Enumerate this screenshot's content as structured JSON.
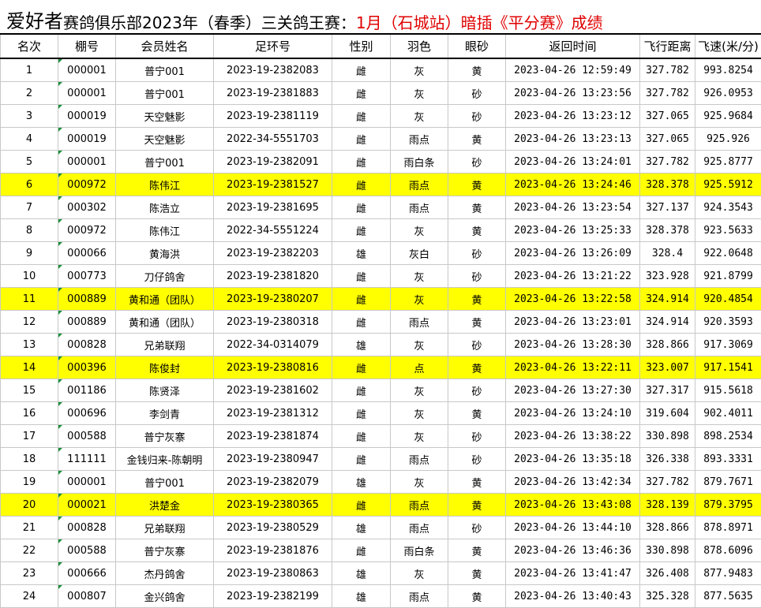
{
  "title": {
    "part1": "爱好者",
    "part2": "赛鸽俱乐部2023年（春季）三关鸽王赛：",
    "part3": "1月（石城站）暗插《平分赛》成绩"
  },
  "columns": [
    "名次",
    "棚号",
    "会员姓名",
    "足环号",
    "性别",
    "羽色",
    "眼砂",
    "返回时间",
    "飞行距离",
    "飞速(米/分)"
  ],
  "highlight_color": "#ffff00",
  "rows": [
    {
      "rank": "1",
      "loft": "000001",
      "name": "普宁001",
      "ring": "2023-19-2382083",
      "sex": "雌",
      "color": "灰",
      "eye": "黄",
      "time": "2023-04-26 12:59:49",
      "dist": "327.782",
      "speed": "993.8254",
      "hl": false
    },
    {
      "rank": "2",
      "loft": "000001",
      "name": "普宁001",
      "ring": "2023-19-2381883",
      "sex": "雌",
      "color": "灰",
      "eye": "砂",
      "time": "2023-04-26 13:23:56",
      "dist": "327.782",
      "speed": "926.0953",
      "hl": false
    },
    {
      "rank": "3",
      "loft": "000019",
      "name": "天空魅影",
      "ring": "2023-19-2381119",
      "sex": "雌",
      "color": "灰",
      "eye": "砂",
      "time": "2023-04-26 13:23:12",
      "dist": "327.065",
      "speed": "925.9684",
      "hl": false
    },
    {
      "rank": "4",
      "loft": "000019",
      "name": "天空魅影",
      "ring": "2022-34-5551703",
      "sex": "雌",
      "color": "雨点",
      "eye": "黄",
      "time": "2023-04-26 13:23:13",
      "dist": "327.065",
      "speed": "925.926",
      "hl": false
    },
    {
      "rank": "5",
      "loft": "000001",
      "name": "普宁001",
      "ring": "2023-19-2382091",
      "sex": "雌",
      "color": "雨白条",
      "eye": "砂",
      "time": "2023-04-26 13:24:01",
      "dist": "327.782",
      "speed": "925.8777",
      "hl": false
    },
    {
      "rank": "6",
      "loft": "000972",
      "name": "陈伟江",
      "ring": "2023-19-2381527",
      "sex": "雌",
      "color": "雨点",
      "eye": "黄",
      "time": "2023-04-26 13:24:46",
      "dist": "328.378",
      "speed": "925.5912",
      "hl": true
    },
    {
      "rank": "7",
      "loft": "000302",
      "name": "陈浩立",
      "ring": "2023-19-2381695",
      "sex": "雌",
      "color": "雨点",
      "eye": "黄",
      "time": "2023-04-26 13:23:54",
      "dist": "327.137",
      "speed": "924.3543",
      "hl": false
    },
    {
      "rank": "8",
      "loft": "000972",
      "name": "陈伟江",
      "ring": "2022-34-5551224",
      "sex": "雌",
      "color": "灰",
      "eye": "黄",
      "time": "2023-04-26 13:25:33",
      "dist": "328.378",
      "speed": "923.5633",
      "hl": false
    },
    {
      "rank": "9",
      "loft": "000066",
      "name": "黄海洪",
      "ring": "2023-19-2382203",
      "sex": "雄",
      "color": "灰白",
      "eye": "砂",
      "time": "2023-04-26 13:26:09",
      "dist": "328.4",
      "speed": "922.0648",
      "hl": false
    },
    {
      "rank": "10",
      "loft": "000773",
      "name": "刀仔鸽舍",
      "ring": "2023-19-2381820",
      "sex": "雌",
      "color": "灰",
      "eye": "砂",
      "time": "2023-04-26 13:21:22",
      "dist": "323.928",
      "speed": "921.8799",
      "hl": false
    },
    {
      "rank": "11",
      "loft": "000889",
      "name": "黄和通（团队）",
      "ring": "2023-19-2380207",
      "sex": "雌",
      "color": "灰",
      "eye": "黄",
      "time": "2023-04-26 13:22:58",
      "dist": "324.914",
      "speed": "920.4854",
      "hl": true
    },
    {
      "rank": "12",
      "loft": "000889",
      "name": "黄和通（团队）",
      "ring": "2023-19-2380318",
      "sex": "雌",
      "color": "雨点",
      "eye": "黄",
      "time": "2023-04-26 13:23:01",
      "dist": "324.914",
      "speed": "920.3593",
      "hl": false
    },
    {
      "rank": "13",
      "loft": "000828",
      "name": "兄弟联翔",
      "ring": "2022-34-0314079",
      "sex": "雄",
      "color": "灰",
      "eye": "砂",
      "time": "2023-04-26 13:28:30",
      "dist": "328.866",
      "speed": "917.3069",
      "hl": false
    },
    {
      "rank": "14",
      "loft": "000396",
      "name": "陈俊封",
      "ring": "2023-19-2380816",
      "sex": "雌",
      "color": "点",
      "eye": "黄",
      "time": "2023-04-26 13:22:11",
      "dist": "323.007",
      "speed": "917.1541",
      "hl": true
    },
    {
      "rank": "15",
      "loft": "001186",
      "name": "陈贤泽",
      "ring": "2023-19-2381602",
      "sex": "雌",
      "color": "灰",
      "eye": "砂",
      "time": "2023-04-26 13:27:30",
      "dist": "327.317",
      "speed": "915.5618",
      "hl": false
    },
    {
      "rank": "16",
      "loft": "000696",
      "name": "李剑青",
      "ring": "2023-19-2381312",
      "sex": "雌",
      "color": "灰",
      "eye": "黄",
      "time": "2023-04-26 13:24:10",
      "dist": "319.604",
      "speed": "902.4011",
      "hl": false
    },
    {
      "rank": "17",
      "loft": "000588",
      "name": "普宁灰寨",
      "ring": "2023-19-2381874",
      "sex": "雌",
      "color": "灰",
      "eye": "砂",
      "time": "2023-04-26 13:38:22",
      "dist": "330.898",
      "speed": "898.2534",
      "hl": false
    },
    {
      "rank": "18",
      "loft": "111111",
      "name": "金钱归来-陈朝明",
      "ring": "2023-19-2380947",
      "sex": "雌",
      "color": "雨点",
      "eye": "砂",
      "time": "2023-04-26 13:35:18",
      "dist": "326.338",
      "speed": "893.3331",
      "hl": false
    },
    {
      "rank": "19",
      "loft": "000001",
      "name": "普宁001",
      "ring": "2023-19-2382079",
      "sex": "雄",
      "color": "灰",
      "eye": "黄",
      "time": "2023-04-26 13:42:34",
      "dist": "327.782",
      "speed": "879.7671",
      "hl": false
    },
    {
      "rank": "20",
      "loft": "000021",
      "name": "洪楚金",
      "ring": "2023-19-2380365",
      "sex": "雌",
      "color": "雨点",
      "eye": "黄",
      "time": "2023-04-26 13:43:08",
      "dist": "328.139",
      "speed": "879.3795",
      "hl": true
    },
    {
      "rank": "21",
      "loft": "000828",
      "name": "兄弟联翔",
      "ring": "2023-19-2380529",
      "sex": "雄",
      "color": "雨点",
      "eye": "砂",
      "time": "2023-04-26 13:44:10",
      "dist": "328.866",
      "speed": "878.8971",
      "hl": false
    },
    {
      "rank": "22",
      "loft": "000588",
      "name": "普宁灰寨",
      "ring": "2023-19-2381876",
      "sex": "雌",
      "color": "雨白条",
      "eye": "黄",
      "time": "2023-04-26 13:46:36",
      "dist": "330.898",
      "speed": "878.6096",
      "hl": false
    },
    {
      "rank": "23",
      "loft": "000666",
      "name": "杰丹鸽舍",
      "ring": "2023-19-2380863",
      "sex": "雄",
      "color": "灰",
      "eye": "黄",
      "time": "2023-04-26 13:41:47",
      "dist": "326.408",
      "speed": "877.9483",
      "hl": false
    },
    {
      "rank": "24",
      "loft": "000807",
      "name": "金兴鸽舍",
      "ring": "2023-19-2382199",
      "sex": "雄",
      "color": "雨点",
      "eye": "黄",
      "time": "2023-04-26 13:40:43",
      "dist": "325.328",
      "speed": "877.5635",
      "hl": false
    }
  ]
}
